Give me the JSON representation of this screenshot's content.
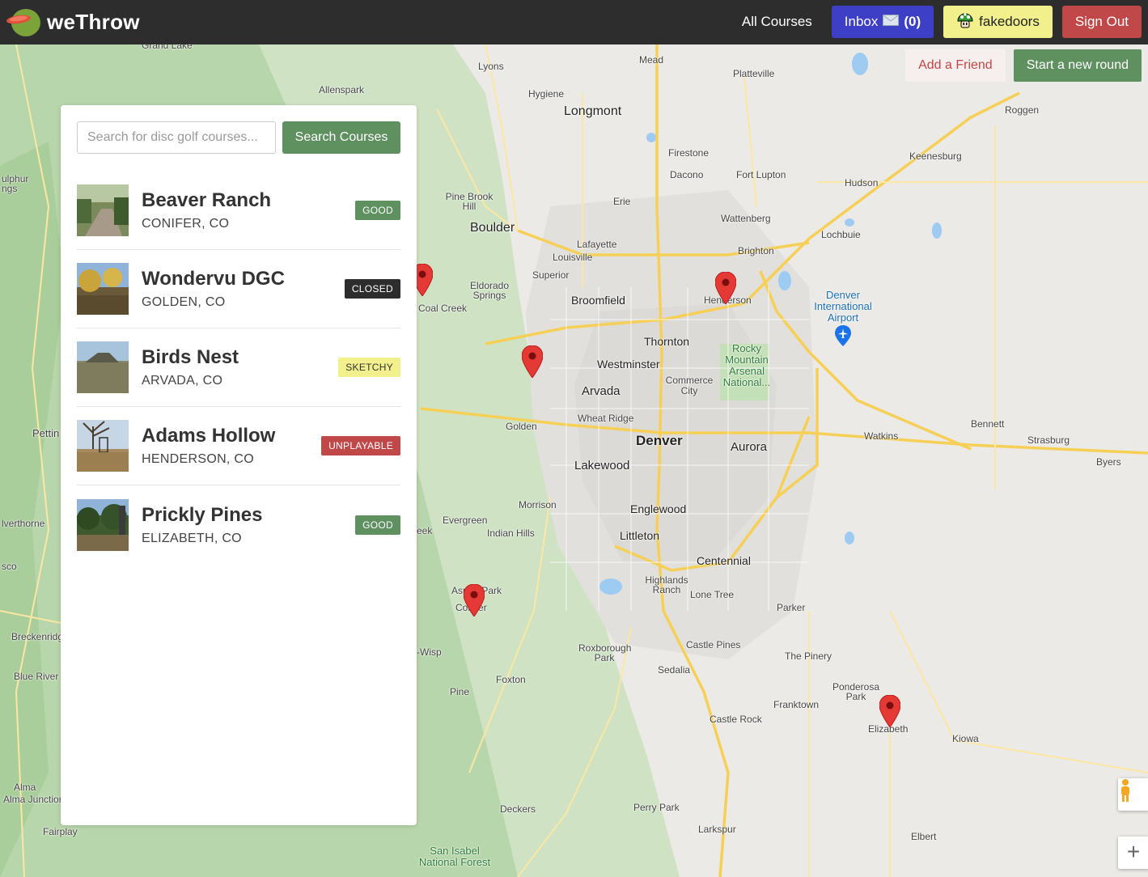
{
  "app": {
    "name": "weThrow"
  },
  "nav": {
    "all_courses": "All Courses",
    "inbox_label": "Inbox",
    "inbox_count": "(0)",
    "username": "fakedoors",
    "sign_out": "Sign Out"
  },
  "map_actions": {
    "add_friend": "Add a Friend",
    "start_round": "Start a new round"
  },
  "search": {
    "placeholder": "Search for disc golf courses...",
    "button": "Search Courses"
  },
  "courses": [
    {
      "name": "Beaver Ranch",
      "location": "CONIFER, CO",
      "status": "GOOD"
    },
    {
      "name": "Wondervu DGC",
      "location": "GOLDEN, CO",
      "status": "CLOSED"
    },
    {
      "name": "Birds Nest",
      "location": "ARVADA, CO",
      "status": "SKETCHY"
    },
    {
      "name": "Adams Hollow",
      "location": "HENDERSON, CO",
      "status": "UNPLAYABLE"
    },
    {
      "name": "Prickly Pines",
      "location": "ELIZABETH, CO",
      "status": "GOOD"
    }
  ],
  "map_labels": {
    "denver": "Denver",
    "aurora": "Aurora",
    "lakewood": "Lakewood",
    "boulder": "Boulder",
    "longmont": "Longmont",
    "arvada": "Arvada",
    "westminster": "Westminster",
    "thornton": "Thornton",
    "broomfield": "Broomfield",
    "englewood": "Englewood",
    "littleton": "Littleton",
    "centennial": "Centennial",
    "golden": "Golden",
    "henderson": "Henderson",
    "brighton": "Brighton",
    "parker": "Parker",
    "castle_rock": "Castle Rock",
    "castle_pines": "Castle Pines",
    "elizabeth": "Elizabeth",
    "kiowa": "Kiowa",
    "conifer": "Conifer",
    "evergreen": "Evergreen",
    "airport": "Denver International Airport",
    "rocky_mountain": "Rocky Mountain Arsenal National...",
    "commerce_city": "Commerce City",
    "wheat_ridge": "Wheat Ridge",
    "lafayette": "Lafayette",
    "louisville": "Louisville",
    "superior": "Superior",
    "erie": "Erie",
    "firestone": "Firestone",
    "dacono": "Dacono",
    "fort_lupton": "Fort Lupton",
    "hudson": "Hudson",
    "keenesburg": "Keenesburg",
    "roggen": "Roggen",
    "platteville": "Platteville",
    "mead": "Mead",
    "lyons": "Lyons",
    "hygiene": "Hygiene",
    "wattenberg": "Wattenberg",
    "lochbuie": "Lochbuie",
    "watkins": "Watkins",
    "bennett": "Bennett",
    "strasburg": "Strasburg",
    "byers": "Byers",
    "morrison": "Morrison",
    "indian_hills": "Indian Hills",
    "highlands_ranch": "Highlands Ranch",
    "lone_tree": "Lone Tree",
    "the_pinery": "The Pinery",
    "ponderosa_park": "Ponderosa Park",
    "franktown": "Franktown",
    "sedalia": "Sedalia",
    "roxborough_park": "Roxborough Park",
    "foxton": "Foxton",
    "pine": "Pine",
    "deckers": "Deckers",
    "perry_park": "Perry Park",
    "larkspur": "Larkspur",
    "elbert": "Elbert",
    "san_isabel": "San Isabel National Forest",
    "coal_creek": "Coal Creek",
    "eldorado_springs": "Eldorado Springs",
    "pine_brook_hill": "Pine Brook Hill",
    "allenspark": "Allenspark",
    "grand_lake": "Grand Lake",
    "breckenridge": "Breckenridge",
    "blue_river": "Blue River",
    "alma": "Alma",
    "alma_junction": "Alma Junction",
    "fairplay": "Fairplay",
    "silverthorne": "lverthorne",
    "frisco": "sco",
    "sulphur": "ulphur",
    "springs": "ngs",
    "pettin": "Pettin",
    "wisp": "-Wisp",
    "aspen_park": "Aspen Park",
    "genesee": "eek"
  }
}
